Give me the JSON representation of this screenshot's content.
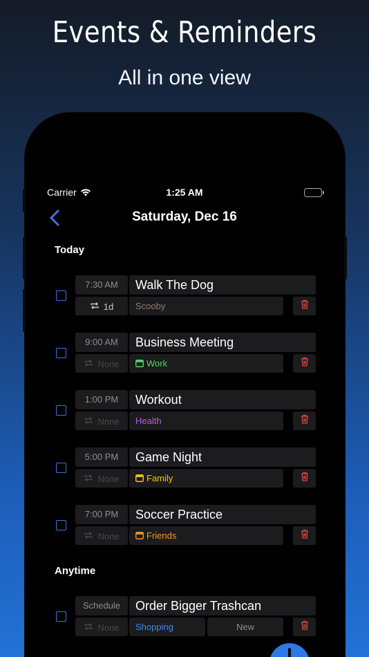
{
  "marketing": {
    "headline": "Events & Reminders",
    "subline": "All in one view"
  },
  "status_bar": {
    "carrier": "Carrier",
    "time": "1:25 AM"
  },
  "nav": {
    "title": "Saturday, Dec 16"
  },
  "sections": {
    "today": "Today",
    "anytime": "Anytime"
  },
  "colors": {
    "accent": "#3f74e0",
    "trash": "#e0473f",
    "work": "#4cd964",
    "health": "#b260e6",
    "family": "#f5c518",
    "friends": "#f5951f",
    "shopping": "#3c8cf0",
    "scooby": "#8e7f6a"
  },
  "events": [
    {
      "time": "7:30 AM",
      "title": "Walk The Dog",
      "repeat": "1d",
      "repeat_active": true,
      "category": "Scooby",
      "category_color": "#8e7f6a",
      "has_calendar_icon": false
    },
    {
      "time": "9:00 AM",
      "title": "Business Meeting",
      "repeat": "None",
      "repeat_active": false,
      "category": "Work",
      "category_color": "#4cd964",
      "has_calendar_icon": true
    },
    {
      "time": "1:00 PM",
      "title": "Workout",
      "repeat": "None",
      "repeat_active": false,
      "category": "Health",
      "category_color": "#b260e6",
      "has_calendar_icon": false
    },
    {
      "time": "5:00 PM",
      "title": "Game Night",
      "repeat": "None",
      "repeat_active": false,
      "category": "Family",
      "category_color": "#f5c518",
      "has_calendar_icon": true
    },
    {
      "time": "7:00 PM",
      "title": "Soccer Practice",
      "repeat": "None",
      "repeat_active": false,
      "category": "Friends",
      "category_color": "#f5951f",
      "has_calendar_icon": true
    }
  ],
  "anytime": [
    {
      "time": "Schedule",
      "title": "Order Bigger Trashcan",
      "repeat": "None",
      "category": "Shopping",
      "category_color": "#3c8cf0",
      "extra": "New"
    }
  ]
}
